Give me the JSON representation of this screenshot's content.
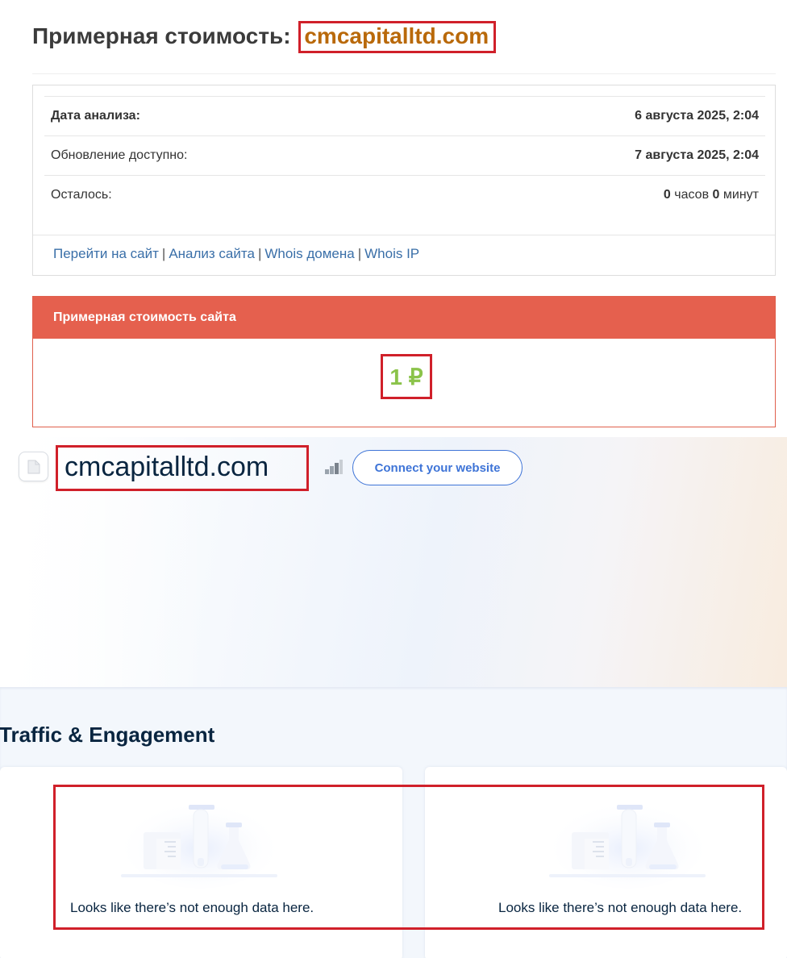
{
  "header": {
    "title_prefix": "Примерная стоимость:",
    "domain": "cmcapitalltd.com"
  },
  "info": {
    "analysis_label": "Дата анализа:",
    "analysis_value": "6 августа 2025, 2:04",
    "update_label": "Обновление доступно:",
    "update_value": "7 августа 2025, 2:04",
    "remaining_label": "Осталось:",
    "remaining_hours": "0",
    "remaining_hours_unit": "часов",
    "remaining_minutes": "0",
    "remaining_minutes_unit": "минут",
    "links": [
      "Перейти на сайт",
      "Анализ сайта",
      "Whois домена",
      "Whois IP"
    ],
    "link_separator": "|"
  },
  "value_card": {
    "title": "Примерная стоимость сайта",
    "value": "1 ₽",
    "colors": {
      "header": "#e5604e",
      "value": "#8bc34a"
    }
  },
  "hero": {
    "site_name": "cmcapitalltd.com",
    "connect_button": "Connect your website",
    "icons": [
      "page-icon",
      "rank-bars-icon"
    ]
  },
  "traffic": {
    "title": "Traffic & Engagement",
    "panels": [
      {
        "message": "Looks like there’s not enough data here.",
        "icon": "lab-illustration-icon"
      },
      {
        "message": "Looks like there’s not enough data here.",
        "icon": "lab-illustration-icon"
      }
    ]
  },
  "colors": {
    "highlight": "#d0202a",
    "domain_text": "#b9690a",
    "link": "#3a6fa8",
    "accent_blue": "#3e74d7",
    "navy": "#092540"
  }
}
